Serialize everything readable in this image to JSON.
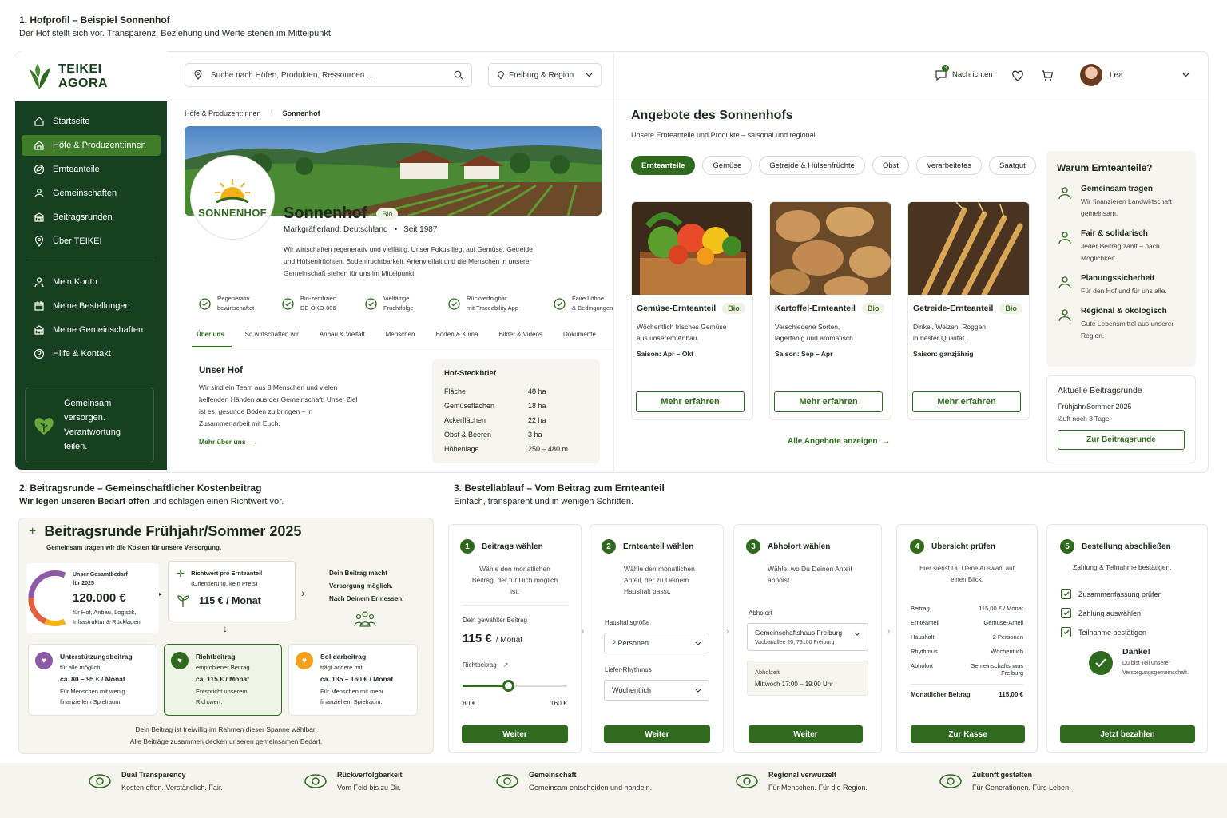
{
  "sections": {
    "one": {
      "title": "1. Hofprofil – Beispiel Sonnenhof",
      "subtitle": "Der Hof stellt sich vor. Transparenz, Beziehung und Werte stehen im Mittelpunkt."
    },
    "two": {
      "title": "2. Beitragsrunde – Gemeinschaftlicher Kostenbeitrag",
      "subtitle_bold": "Wir legen unseren Bedarf offen",
      "subtitle_rest": " und schlagen einen Richtwert vor."
    },
    "three": {
      "title": "3. Bestellablauf – Vom Beitrag zum Ernteanteil",
      "subtitle": "Einfach, transparent und in wenigen Schritten."
    }
  },
  "brand": {
    "line1": "TEIKEI",
    "line2": "AGORA"
  },
  "sidebar": {
    "items": [
      {
        "label": "Startseite",
        "icon": "home-icon"
      },
      {
        "label": "Höfe & Produzent:innen",
        "icon": "farm-icon",
        "active": true
      },
      {
        "label": "Ernteanteile",
        "icon": "leaf-icon"
      },
      {
        "label": "Gemeinschaften",
        "icon": "people-icon"
      },
      {
        "label": "Beitragsrunden",
        "icon": "building-icon"
      },
      {
        "label": "Über TEIKEI",
        "icon": "location-icon"
      }
    ],
    "items2": [
      {
        "label": "Mein Konto",
        "icon": "user-icon"
      },
      {
        "label": "Meine Bestellungen",
        "icon": "calendar-icon"
      },
      {
        "label": "Meine Gemeinschaften",
        "icon": "building-icon"
      },
      {
        "label": "Hilfe & Kontakt",
        "icon": "help-icon"
      }
    ],
    "promo": "Gemeinsam versorgen. Verantwortung teilen."
  },
  "topbar": {
    "search_placeholder": "Suche nach Höfen, Produkten, Ressourcen ...",
    "region": "Freiburg & Region",
    "messages": "Nachrichten",
    "messages_count": "3",
    "user": "Lea"
  },
  "breadcrumb": {
    "parent": "Höfe & Produzent:innen",
    "current": "Sonnenhof"
  },
  "farm": {
    "logo_text": "SONNENHOF",
    "name": "Sonnenhof",
    "badge": "Bio",
    "location": "Markgräflerland, Deutschland",
    "since": "Seit 1987",
    "description": "Wir wirtschaften regenerativ und vielfältig. Unser Fokus liegt auf Gemüse, Getreide und Hülsenfrüchten. Bodenfruchtbarkeit, Artenvielfalt und die Menschen in unserer Gemeinschaft stehen für uns im Mittelpunkt.",
    "features": [
      {
        "l1": "Regenerativ",
        "l2": "bewirtschaftet",
        "icon": "sprout-icon"
      },
      {
        "l1": "Bio-zertifiziert",
        "l2": "DE-ÖKO-006",
        "icon": "certificate-icon"
      },
      {
        "l1": "Vielfältige",
        "l2": "Fruchtfolge",
        "icon": "rotation-icon"
      },
      {
        "l1": "Rückverfolgbar",
        "l2": "mit Traceability App",
        "icon": "shield-icon"
      },
      {
        "l1": "Faire Löhne",
        "l2": "& Bedingungen",
        "icon": "handshake-icon"
      }
    ],
    "tabs": [
      "Über uns",
      "So wirtschaften wir",
      "Anbau & Vielfalt",
      "Menschen",
      "Boden & Klima",
      "Bilder & Videos",
      "Dokumente"
    ],
    "about_title": "Unser Hof",
    "about_text": "Wir sind ein Team aus 8 Menschen und vielen helfenden Händen aus der Gemeinschaft. Unser Ziel ist es, gesunde Böden zu bringen – in Zusammenarbeit mit Euch.",
    "about_link": "Mehr über uns",
    "facts_title": "Hof-Steckbrief",
    "facts": [
      {
        "k": "Fläche",
        "v": "48 ha"
      },
      {
        "k": "Gemüseflächen",
        "v": "18 ha"
      },
      {
        "k": "Ackerflächen",
        "v": "22 ha"
      },
      {
        "k": "Obst & Beeren",
        "v": "3 ha"
      },
      {
        "k": "Höhenlage",
        "v": "250 – 480 m"
      }
    ]
  },
  "offers": {
    "title": "Angebote des Sonnenhofs",
    "subtitle": "Unsere Ernteanteile und Produkte – saisonal und regional.",
    "chips": [
      "Ernteanteile",
      "Gemüse",
      "Getreide & Hülsenfrüchte",
      "Obst",
      "Verarbeitetes",
      "Saatgut"
    ],
    "cards": [
      {
        "title": "Gemüse-Ernteanteil",
        "badge": "Bio",
        "d1": "Wöchentlich frisches Gemüse",
        "d2": "aus unserem Anbau.",
        "season": "Saison: Apr – Okt",
        "button": "Mehr erfahren"
      },
      {
        "title": "Kartoffel-Ernteanteil",
        "badge": "Bio",
        "d1": "Verschiedene Sorten,",
        "d2": "lagerfähig und aromatisch.",
        "season": "Saison: Sep – Apr",
        "button": "Mehr erfahren"
      },
      {
        "title": "Getreide-Ernteanteil",
        "badge": "Bio",
        "d1": "Dinkel, Weizen, Roggen",
        "d2": "in bester Qualität.",
        "season": "Saison: ganzjährig",
        "button": "Mehr erfahren"
      }
    ],
    "all_link": "Alle Angebote anzeigen"
  },
  "why": {
    "title": "Warum Ernteanteile?",
    "items": [
      {
        "t": "Gemeinsam tragen",
        "d": "Wir finanzieren Landwirtschaft gemeinsam.",
        "icon": "group-icon"
      },
      {
        "t": "Fair & solidarisch",
        "d": "Jeder Beitrag zählt – nach Möglichkeit.",
        "icon": "coin-icon"
      },
      {
        "t": "Planungssicherheit",
        "d": "Für den Hof und für uns alle.",
        "icon": "plant-hand-icon"
      },
      {
        "t": "Regional & ökologisch",
        "d": "Gute Lebensmittel aus unserer Region.",
        "icon": "map-pin-icon"
      }
    ]
  },
  "current_round": {
    "title": "Aktuelle Beitragsrunde",
    "name": "Frühjahr/Sommer 2025",
    "remaining": "läuft noch 8 Tage",
    "button": "Zur Beitragsrunde"
  },
  "round": {
    "title": "Beitragsrunde Frühjahr/Sommer 2025",
    "subtitle": "Gemeinsam tragen wir die Kosten für unsere Versorgung.",
    "need_l1": "Unser Gesamtbedarf",
    "need_l2": "für 2025",
    "need_amount": "120.000 €",
    "need_d1": "für Hof, Anbau, Logistik,",
    "need_d2": "Infrastruktur & Rücklagen",
    "rec_title": "Richtwert pro Ernteanteil",
    "rec_note": "(Orientierung, kein Preis)",
    "rec_amount": "115 € / Monat",
    "your_l1": "Dein Beitrag macht",
    "your_l2": "Versorgung möglich.",
    "your_l3": "Nach Deinem Ermessen.",
    "options": [
      {
        "t": "Unterstützungsbeitrag",
        "s": "für alle möglich",
        "a": "ca. 80 – 95 € / Monat",
        "d1": "Für Menschen mit wenig",
        "d2": "finanziellem Spielraum."
      },
      {
        "t": "Richtbeitrag",
        "s": "empfohlener Beitrag",
        "a": "ca. 115 € / Monat",
        "d1": "Entspricht unserem",
        "d2": "Richtwert."
      },
      {
        "t": "Solidarbeitrag",
        "s": "trägt andere mit",
        "a": "ca. 135 – 160 € / Monat",
        "d1": "Für Menschen mit mehr",
        "d2": "finanziellem Spielraum."
      }
    ],
    "note1": "Dein Beitrag ist freiwillig im Rahmen dieser Spanne wählbar.",
    "note2": "Alle Beiträge zusammen decken unseren gemeinsamen Bedarf."
  },
  "steps": [
    {
      "n": "1",
      "title": "Beitrags wählen",
      "desc": "Wähle den monatlichen Beitrag, der für Dich möglich ist.",
      "chosen_label": "Dein gewählter Beitrag",
      "chosen_amount": "115 €",
      "chosen_unit": "/ Monat",
      "rec_label": "Richtbeitrag",
      "min": "80 €",
      "max": "160 €",
      "button": "Weiter"
    },
    {
      "n": "2",
      "title": "Ernteanteil wählen",
      "desc": "Wähle den monatlichen Anteil, der zu Deinem Haushalt passt.",
      "size_label": "Haushaltsgröße",
      "size": "2 Personen",
      "rhythm_label": "Liefer-Rhythmus",
      "rhythm": "Wöchentlich",
      "button": "Weiter"
    },
    {
      "n": "3",
      "title": "Abholort wählen",
      "desc": "Wähle, wo Du Deinen Anteil abholst.",
      "place_label": "Abholort",
      "place": "Gemeinschaftshaus Freiburg",
      "address": "Vaubanallee 20, 79100 Freiburg",
      "time_label": "Abholzeit",
      "time": "Mittwoch 17:00 – 19:00 Uhr",
      "button": "Weiter"
    },
    {
      "n": "4",
      "title": "Übersicht prüfen",
      "desc": "Hier siehst Du Deine Auswahl auf einen Blick.",
      "rows": [
        {
          "k": "Beitrag",
          "v": "115,00 € / Monat"
        },
        {
          "k": "Ernteanteil",
          "v": "Gemüse-Anteil"
        },
        {
          "k": "Haushalt",
          "v": "2 Personen"
        },
        {
          "k": "Rhythmus",
          "v": "Wöchentlich"
        },
        {
          "k": "Abholort",
          "v": "Gemeinschaftshaus Freiburg"
        }
      ],
      "total_label": "Monatlicher Beitrag",
      "total": "115,00 €",
      "button": "Zur Kasse"
    },
    {
      "n": "5",
      "title": "Bestellung abschließen",
      "desc": "Zahlung & Teilnahme bestätigen.",
      "checks": [
        "Zusammenfassung prüfen",
        "Zahlung auswählen",
        "Teilnahme bestätigen"
      ],
      "thanks": "Danke!",
      "thanks_d": "Du bist Teil unserer Versorgungsgemeinschaft.",
      "button": "Jetzt bezahlen"
    }
  ],
  "slider": {
    "min": 80,
    "max": 160,
    "value": 115
  },
  "footer": [
    {
      "t": "Dual Transparency",
      "d": "Kosten offen. Verständlich. Fair.",
      "icon": "eye-icon"
    },
    {
      "t": "Rückverfolgbarkeit",
      "d": "Vom Feld bis zu Dir.",
      "icon": "sprout-icon"
    },
    {
      "t": "Gemeinschaft",
      "d": "Gemeinsam entscheiden und handeln.",
      "icon": "group-icon"
    },
    {
      "t": "Regional verwurzelt",
      "d": "Für Menschen. Für die Region.",
      "icon": "people-icon"
    },
    {
      "t": "Zukunft gestalten",
      "d": "Für Generationen. Fürs Leben.",
      "icon": "heart-icon"
    }
  ],
  "colors": {
    "primary": "#2f6a1f",
    "sidebar": "#16401f",
    "beige": "#f6f5ef"
  }
}
